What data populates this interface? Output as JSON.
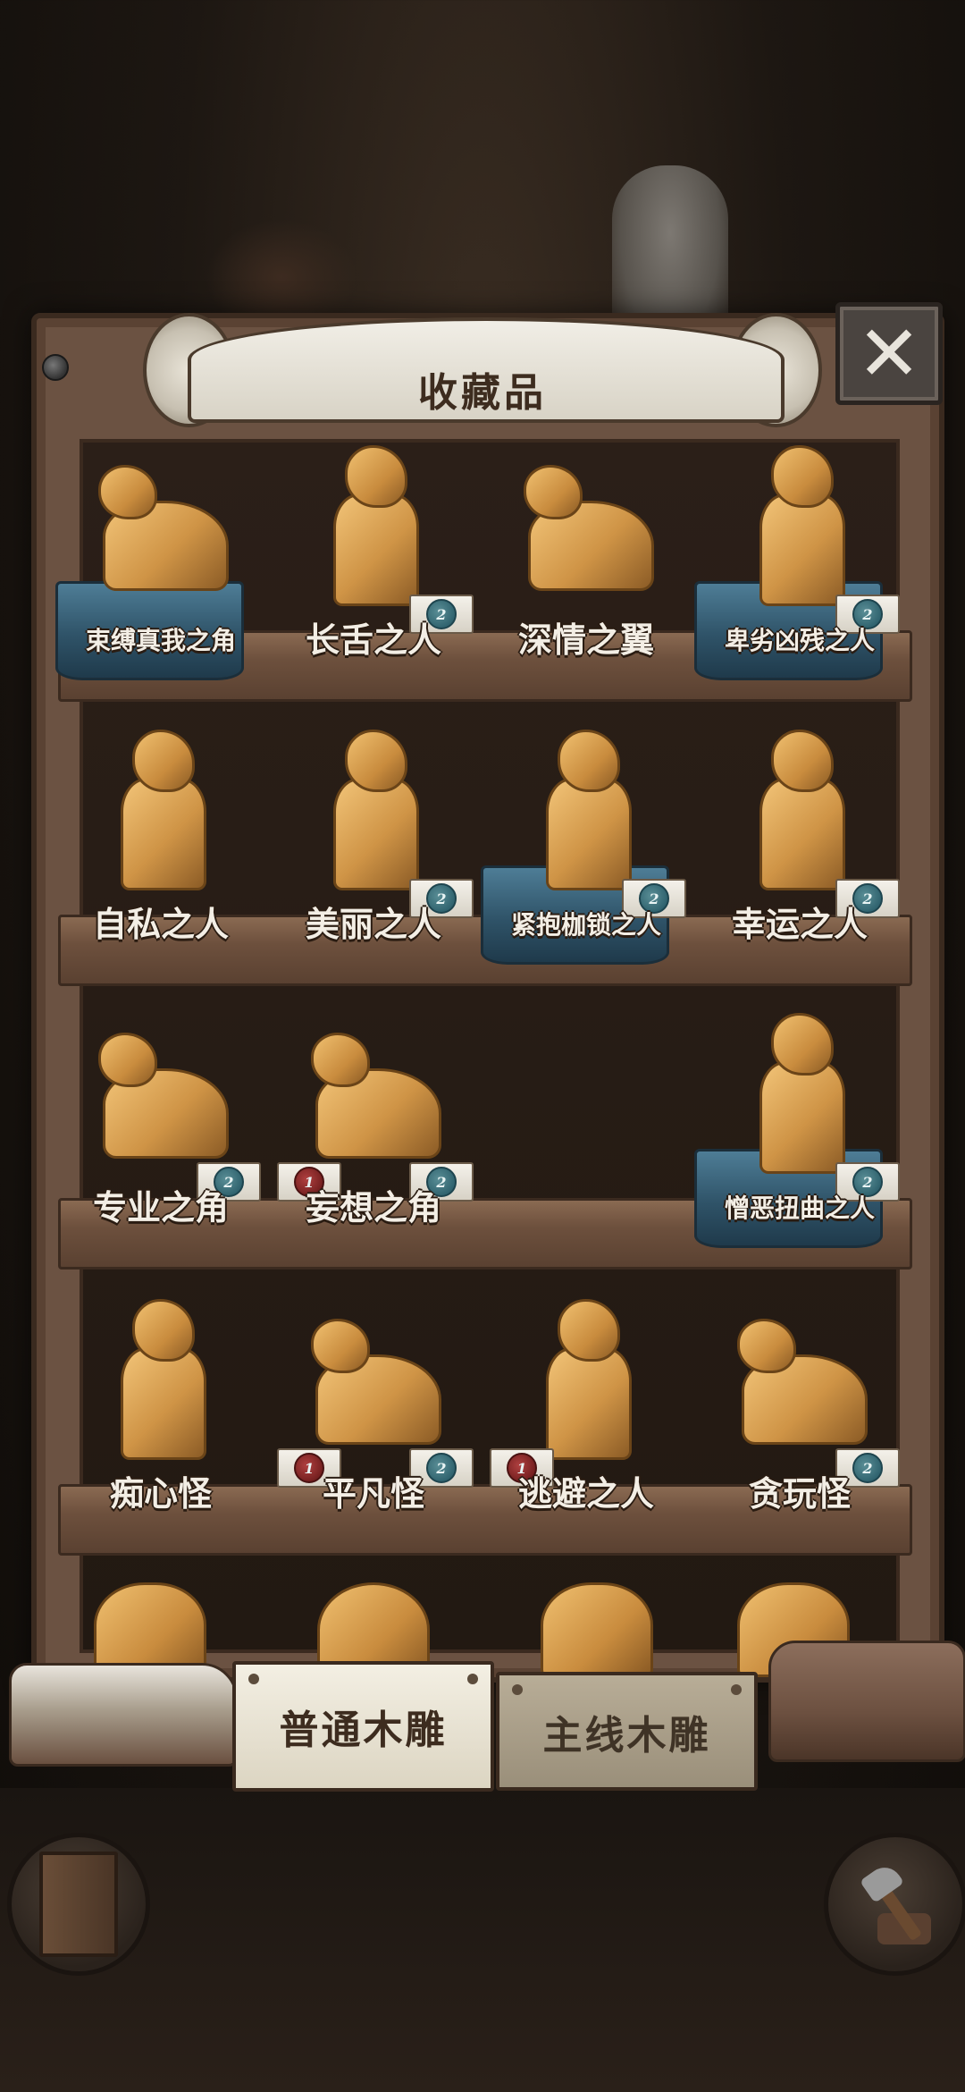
{
  "header": {
    "title": "收藏品",
    "close_icon": "close-x-icon"
  },
  "tabs": [
    {
      "label": "普通木雕",
      "active": true
    },
    {
      "label": "主线木雕",
      "active": false
    }
  ],
  "shelves": [
    [
      {
        "name": "束缚真我之角",
        "count": "",
        "cloth": true,
        "shape": "animal",
        "small": true
      },
      {
        "name": "长舌之人",
        "count": "2",
        "cloth": false,
        "shape": "person",
        "small": false
      },
      {
        "name": "深情之翼",
        "count": "",
        "cloth": false,
        "shape": "animal",
        "small": false
      },
      {
        "name": "卑劣凶残之人",
        "count": "2",
        "cloth": true,
        "shape": "person",
        "small": true
      }
    ],
    [
      {
        "name": "自私之人",
        "count": "",
        "cloth": false,
        "shape": "person",
        "small": false
      },
      {
        "name": "美丽之人",
        "count": "2",
        "cloth": false,
        "shape": "person",
        "small": false
      },
      {
        "name": "紧抱枷锁之人",
        "count": "2",
        "cloth": true,
        "shape": "person",
        "small": true
      },
      {
        "name": "幸运之人",
        "count": "2",
        "cloth": false,
        "shape": "person",
        "small": false
      }
    ],
    [
      {
        "name": "专业之角",
        "count": "2",
        "cloth": false,
        "shape": "animal",
        "small": false
      },
      {
        "name": "妄想之角",
        "count": "2",
        "red": "1",
        "cloth": false,
        "shape": "animal",
        "small": false
      },
      {
        "name": "",
        "count": "",
        "cloth": false,
        "shape": "none",
        "small": false
      },
      {
        "name": "憎恶扭曲之人",
        "count": "2",
        "cloth": true,
        "shape": "person",
        "small": true
      }
    ],
    [
      {
        "name": "痴心怪",
        "count": "",
        "cloth": false,
        "shape": "person",
        "small": false
      },
      {
        "name": "平凡怪",
        "count": "2",
        "red": "1",
        "cloth": false,
        "shape": "animal",
        "small": false
      },
      {
        "name": "逃避之人",
        "count": "",
        "red": "1",
        "cloth": false,
        "shape": "person",
        "small": false
      },
      {
        "name": "贪玩怪",
        "count": "2",
        "cloth": false,
        "shape": "animal",
        "small": false
      }
    ]
  ],
  "nav": {
    "left_icon": "door-icon",
    "right_icon": "axe-stump-icon"
  },
  "colors": {
    "wood": "#6b5242",
    "cloth": "#2f5368",
    "gold": "#cf9446",
    "paper": "#f3efe3"
  }
}
